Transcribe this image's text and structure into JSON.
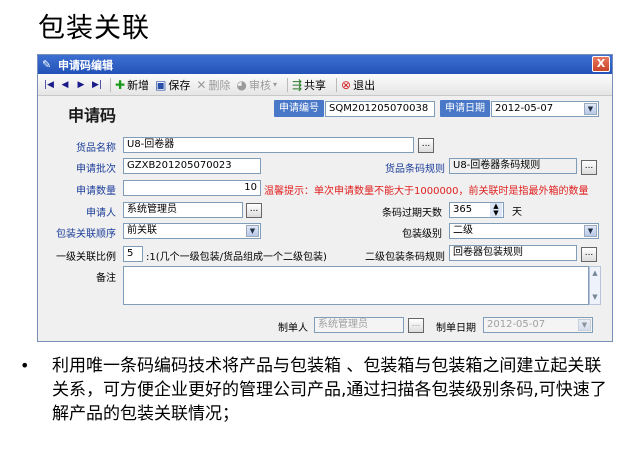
{
  "slide": {
    "title": "包装关联",
    "bullet": "利用唯一条码编码技术将产品与包装箱 、包装箱与包装箱之间建立起关联关系，可方便企业更好的管理公司产品,通过扫描各包装级别条码,可快速了解产品的包装关联情况；"
  },
  "window": {
    "title": "申请码编辑",
    "close": "X"
  },
  "toolbar": {
    "add": "新增",
    "save": "保存",
    "delete": "删除",
    "audit": "审核",
    "share": "共享",
    "exit": "退出"
  },
  "form": {
    "heading": "申请码",
    "apply_no_label": "申请编号",
    "apply_no": "SQM201205070038",
    "apply_date_label": "申请日期",
    "apply_date": "2012-05-07",
    "product_name_label": "货品名称",
    "product_name": "U8-回卷器",
    "batch_label": "申请批次",
    "batch": "GZXB201205070023",
    "barcode_rule_label": "货品条码规则",
    "barcode_rule": "U8-回卷器条码规则",
    "qty_label": "申请数量",
    "qty": "10",
    "warning": "温馨提示：单次申请数量不能大于1000000，前关联时是指最外箱的数量",
    "applicant_label": "申请人",
    "applicant": "系统管理员",
    "expiry_label": "条码过期天数",
    "expiry_days": "365",
    "days_unit": "天",
    "order_label": "包装关联顺序",
    "order": "前关联",
    "level_label": "包装级别",
    "level": "二级",
    "ratio_label": "一级关联比例",
    "ratio": "5",
    "ratio_hint": ":1(几个一级包装/货品组成一个二级包装)",
    "level2_rule_label": "二级包装条码规则",
    "level2_rule": "回卷器包装规则",
    "remark_label": "备注",
    "remark": "",
    "maker_label": "制单人",
    "maker": "系统管理员",
    "make_date_label": "制单日期",
    "make_date": "2012-05-07"
  }
}
